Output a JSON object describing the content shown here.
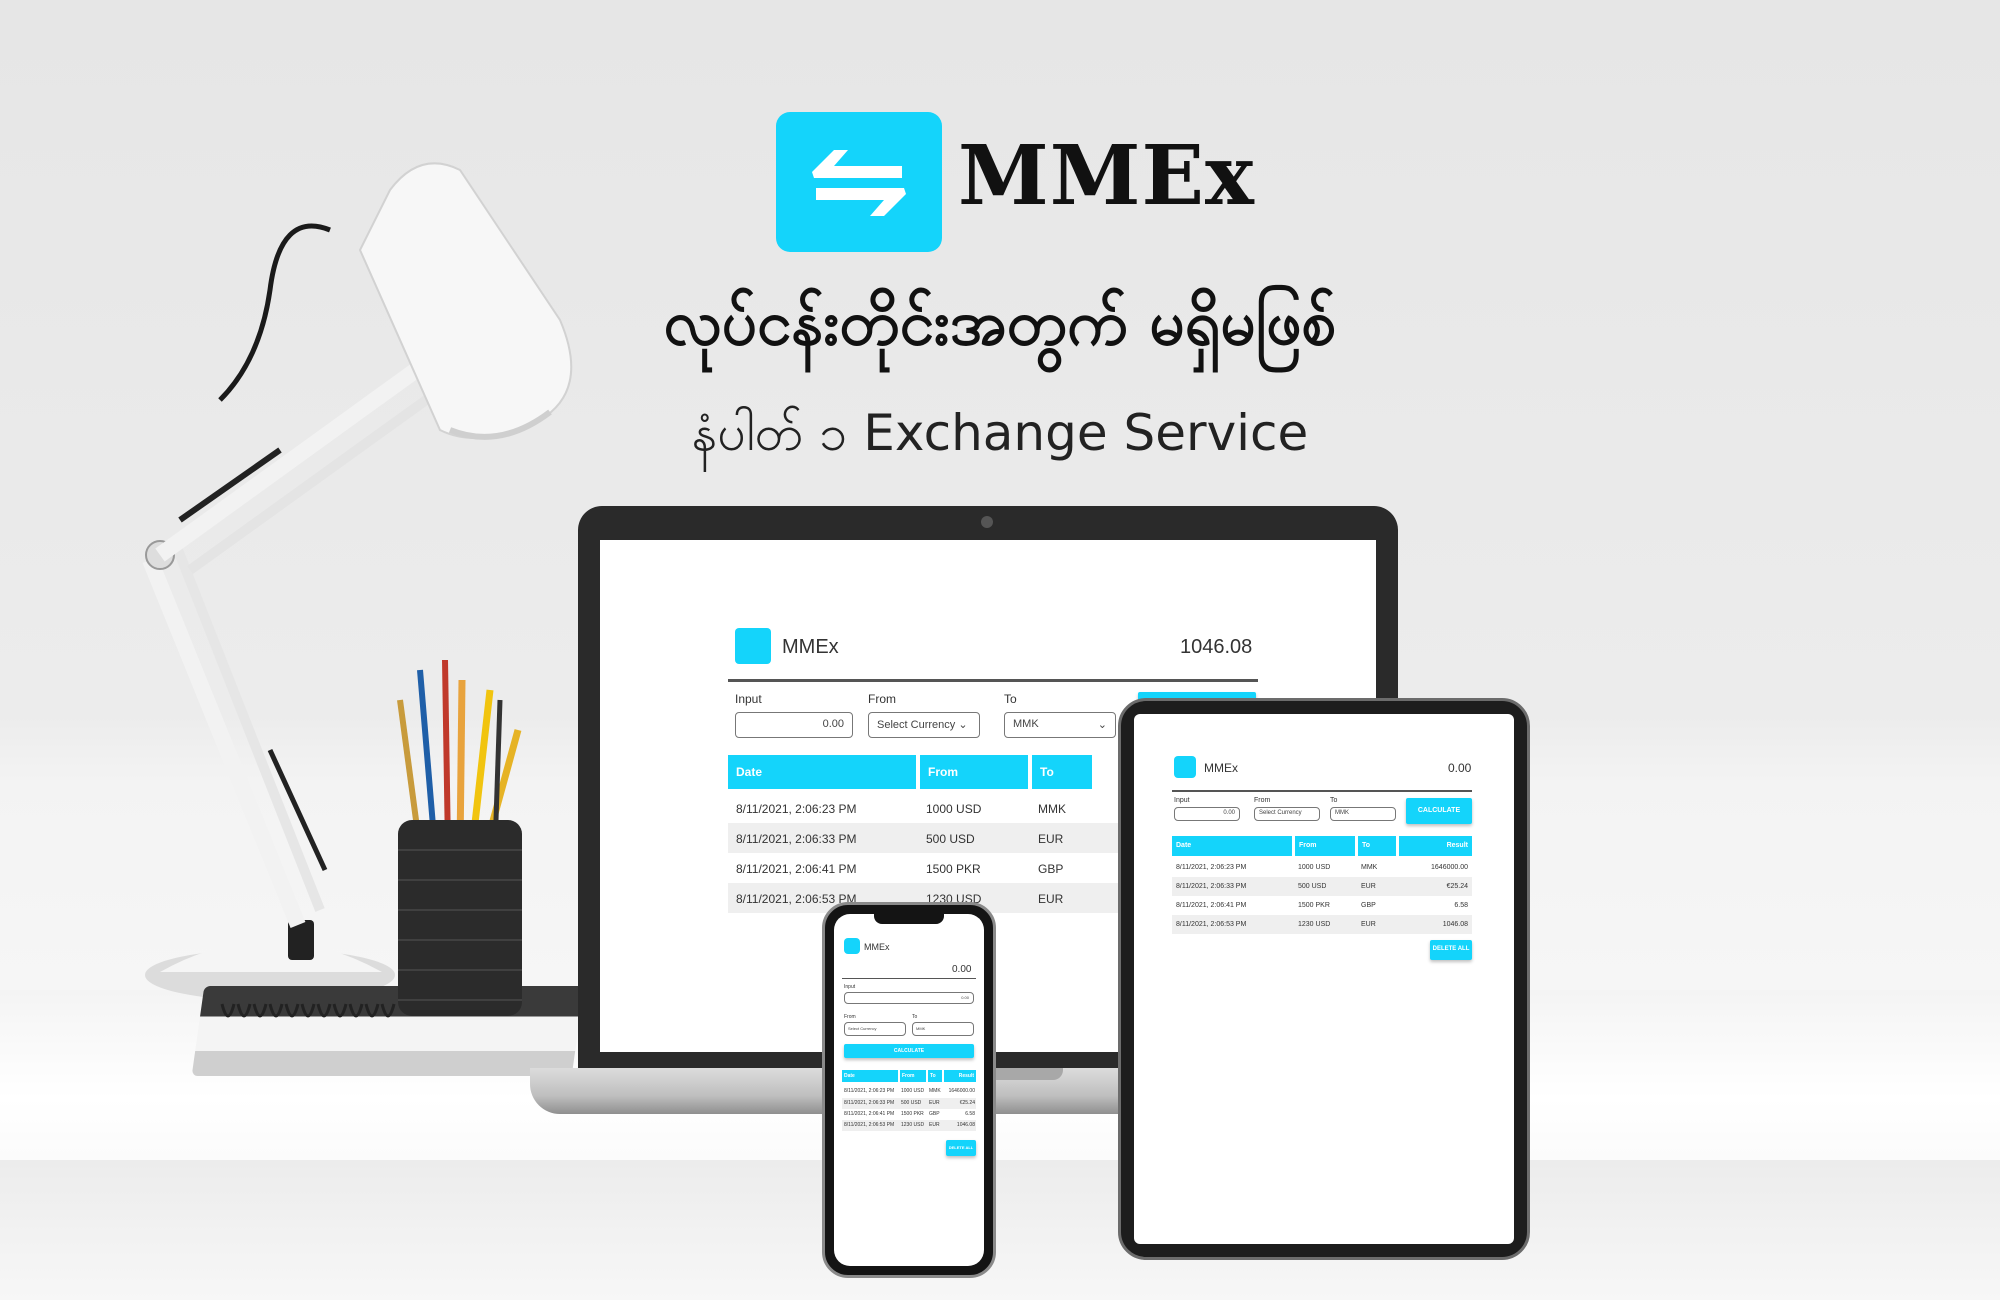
{
  "brand": {
    "name": "MMEx",
    "tagline": "လုပ်ငန်းတိုင်းအတွက် မရှိမဖြစ်",
    "subline": "နံပါတ် ၁ Exchange Service"
  },
  "colors": {
    "accent": "#14d4fb",
    "text": "#111111"
  },
  "icons": {
    "logo": "exchange-arrows-icon"
  },
  "laptop_app": {
    "title": "MMEx",
    "result": "1046.08",
    "input_label": "Input",
    "input_value": "0.00",
    "from_label": "From",
    "from_value": "Select Currency",
    "to_label": "To",
    "to_value": "MMK",
    "columns": [
      "Date",
      "From",
      "To"
    ],
    "rows": [
      [
        "8/11/2021, 2:06:23 PM",
        "1000 USD",
        "MMK"
      ],
      [
        "8/11/2021, 2:06:33 PM",
        "500 USD",
        "EUR"
      ],
      [
        "8/11/2021, 2:06:41 PM",
        "1500 PKR",
        "GBP"
      ],
      [
        "8/11/2021, 2:06:53 PM",
        "1230 USD",
        "EUR"
      ]
    ]
  },
  "tablet_app": {
    "title": "MMEx",
    "result": "0.00",
    "input_label": "Input",
    "input_value": "0.00",
    "from_label": "From",
    "from_value": "Select Currency",
    "to_label": "To",
    "to_value": "MMK",
    "calculate": "CALCULATE",
    "delete_all": "DELETE ALL",
    "columns": [
      "Date",
      "From",
      "To",
      "Result"
    ],
    "rows": [
      [
        "8/11/2021, 2:06:23 PM",
        "1000 USD",
        "MMK",
        "1646000.00"
      ],
      [
        "8/11/2021, 2:06:33 PM",
        "500 USD",
        "EUR",
        "€25.24"
      ],
      [
        "8/11/2021, 2:06:41 PM",
        "1500 PKR",
        "GBP",
        "6.58"
      ],
      [
        "8/11/2021, 2:06:53 PM",
        "1230 USD",
        "EUR",
        "1046.08"
      ]
    ]
  },
  "phone_app": {
    "title": "MMEx",
    "result": "0.00",
    "input_label": "Input",
    "input_value": "0.00",
    "from_label": "From",
    "from_value": "Select Currency",
    "to_label": "To",
    "to_value": "MMK",
    "calculate": "CALCULATE",
    "delete_all": "DELETE ALL",
    "columns": [
      "Date",
      "From",
      "To",
      "Result"
    ],
    "rows": [
      [
        "8/11/2021, 2:06:23 PM",
        "1000 USD",
        "MMK",
        "1646000.00"
      ],
      [
        "8/11/2021, 2:06:33 PM",
        "500 USD",
        "EUR",
        "€25.24"
      ],
      [
        "8/11/2021, 2:06:41 PM",
        "1500 PKR",
        "GBP",
        "6.58"
      ],
      [
        "8/11/2021, 2:06:53 PM",
        "1230 USD",
        "EUR",
        "1046.08"
      ]
    ]
  }
}
